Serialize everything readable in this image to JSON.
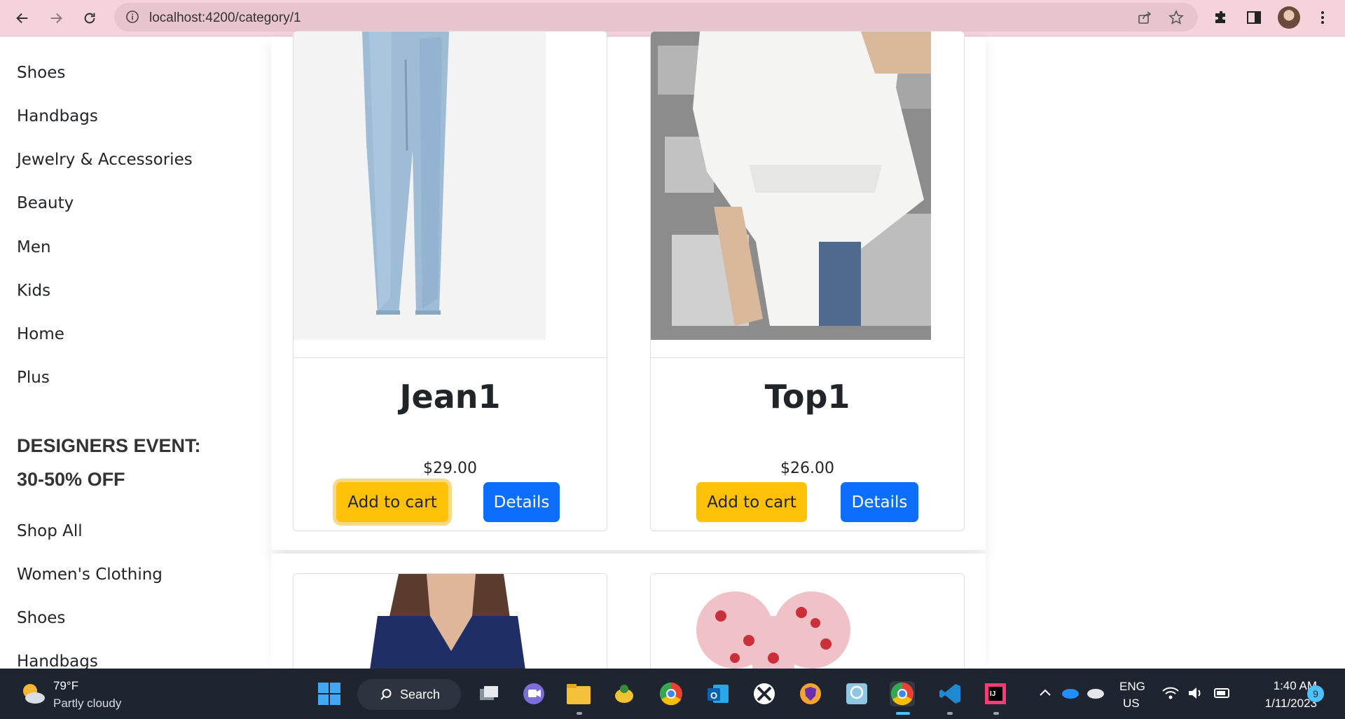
{
  "browser": {
    "url": "localhost:4200/category/1"
  },
  "sidebar": {
    "items": [
      "Shoes",
      "Handbags",
      "Jewelry & Accessories",
      "Beauty",
      "Men",
      "Kids",
      "Home",
      "Plus"
    ],
    "promo_line1": "DESIGNERS EVENT:",
    "promo_line2": "30-50% OFF",
    "items2": [
      "Shop All",
      "Women's Clothing",
      "Shoes",
      "Handbags"
    ]
  },
  "products": [
    {
      "name": "Jean1",
      "price": "$29.00",
      "cart_label": "Add to cart",
      "details_label": "Details",
      "image_icon": "jeans-image"
    },
    {
      "name": "Top1",
      "price": "$26.00",
      "cart_label": "Add to cart",
      "details_label": "Details",
      "image_icon": "white-top-image"
    }
  ],
  "colors": {
    "browser_bar": "#f5d3dc",
    "add_to_cart": "#ffc107",
    "details": "#0d6efd",
    "taskbar": "#1f2530"
  },
  "taskbar": {
    "weather_temp": "79°F",
    "weather_desc": "Partly cloudy",
    "search_label": "Search",
    "lang_line1": "ENG",
    "lang_line2": "US",
    "time": "1:40 AM",
    "date": "1/11/2023",
    "notification_count": "9"
  }
}
